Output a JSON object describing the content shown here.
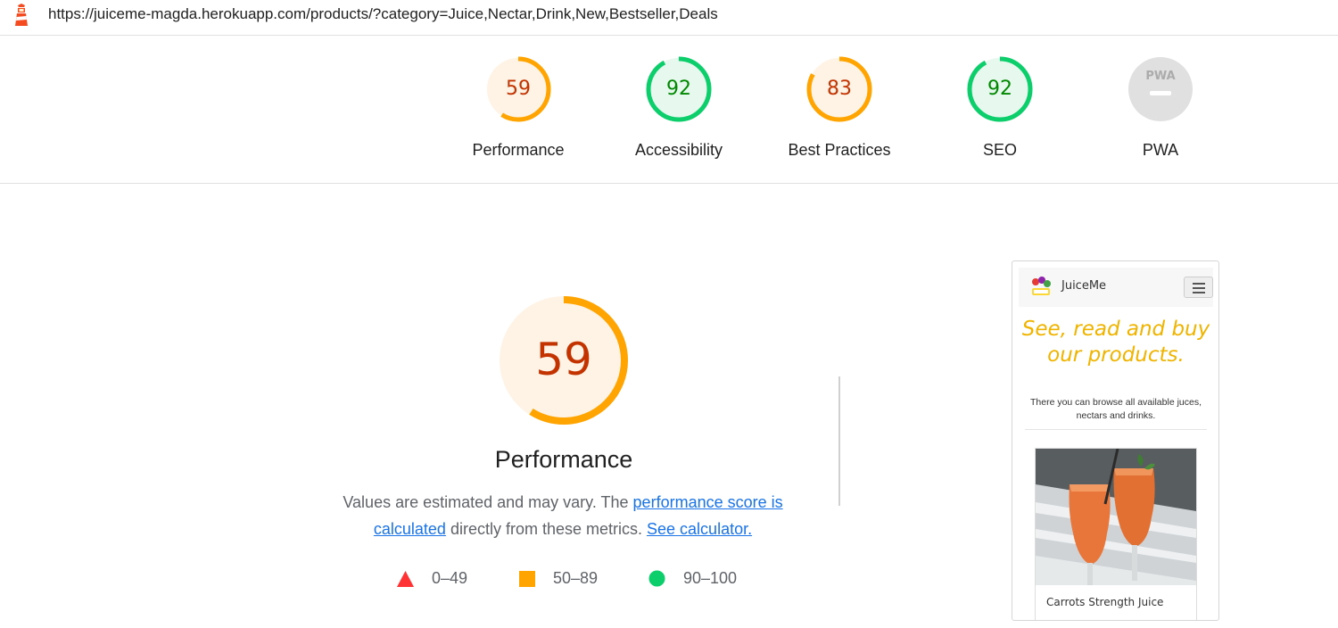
{
  "topbar": {
    "url": "https://juiceme-magda.herokuapp.com/products/?category=Juice,Nectar,Drink,New,Bestseller,Deals",
    "logo_icon": "lighthouse-icon"
  },
  "colors": {
    "average": "#ffa400",
    "average_text": "#c33300",
    "pass": "#0cce6b",
    "pass_text": "#008800",
    "fail": "#ff3333",
    "neutral": "#e0e0e0",
    "link": "#1a73e8",
    "hero_yellow": "#f0b400"
  },
  "gauges": [
    {
      "label": "Performance",
      "score": "59",
      "value": 0.59,
      "status": "average"
    },
    {
      "label": "Accessibility",
      "score": "92",
      "value": 0.92,
      "status": "pass"
    },
    {
      "label": "Best Practices",
      "score": "83",
      "value": 0.83,
      "status": "average"
    },
    {
      "label": "SEO",
      "score": "92",
      "value": 0.92,
      "status": "pass"
    },
    {
      "label": "PWA",
      "score": "",
      "value": 0,
      "status": "pwa",
      "badge": "PWA"
    }
  ],
  "performance": {
    "score": "59",
    "value": 0.59,
    "title": "Performance",
    "desc_part1": "Values are estimated and may vary. The ",
    "desc_link1": "performance score is calculated",
    "desc_part2": " directly from these metrics. ",
    "desc_link2": "See calculator."
  },
  "legend": [
    {
      "shape": "triangle-icon",
      "range": "0–49",
      "color": "#ff3333"
    },
    {
      "shape": "square-icon",
      "range": "50–89",
      "color": "#ffa400"
    },
    {
      "shape": "circle-icon",
      "range": "90–100",
      "color": "#0cce6b"
    }
  ],
  "screenshot": {
    "brand": "JuiceMe",
    "menu_icon": "hamburger-icon",
    "hero_title": "See, read and buy our products.",
    "hero_subtitle": "There you can browse all available juces, nectars and drinks.",
    "card_title": "Carrots Strength Juice"
  }
}
